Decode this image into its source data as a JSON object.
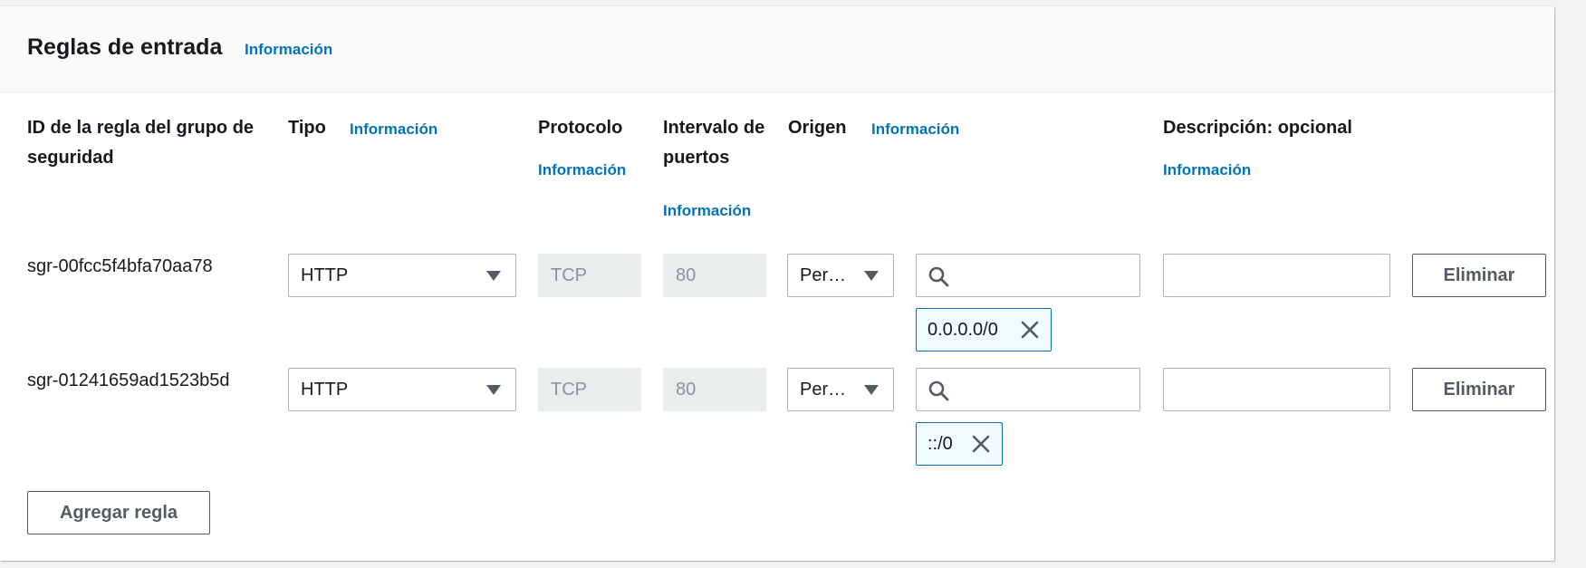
{
  "panel": {
    "title": "Reglas de entrada",
    "info": "Información"
  },
  "columns": {
    "id": "ID de la regla del grupo de seguridad",
    "type": "Tipo",
    "type_info": "Información",
    "protocol": "Protocolo",
    "protocol_info": "Información",
    "port_range": "Intervalo de puertos",
    "port_range_info": "Información",
    "source": "Origen",
    "source_info": "Información",
    "description": "Descripción: opcional",
    "description_info": "Información"
  },
  "rules": [
    {
      "id": "sgr-00fcc5f4bfa70aa78",
      "type": "HTTP",
      "protocol": "TCP",
      "port_range": "80",
      "source_type": "Per…",
      "source_search": "",
      "source_token": "0.0.0.0/0",
      "description": "",
      "delete_label": "Eliminar"
    },
    {
      "id": "sgr-01241659ad1523b5d",
      "type": "HTTP",
      "protocol": "TCP",
      "port_range": "80",
      "source_type": "Per…",
      "source_search": "",
      "source_token": "::/0",
      "description": "",
      "delete_label": "Eliminar"
    }
  ],
  "add_rule_label": "Agregar regla",
  "colors": {
    "link": "#0073bb",
    "text": "#16191f",
    "token_bg": "#f1faff",
    "disabled_bg": "#eaeded"
  },
  "icons": {
    "search": "search-icon",
    "caret": "caret-down-icon",
    "remove": "close-icon"
  }
}
